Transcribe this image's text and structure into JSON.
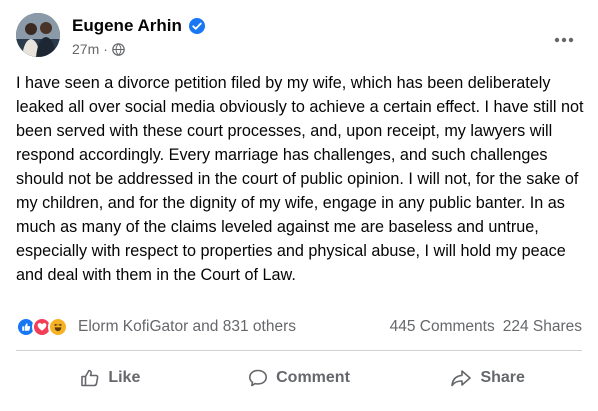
{
  "post": {
    "author": "Eugene Arhin",
    "timestamp": "27m",
    "separator": "·",
    "privacy_icon": "globe-icon",
    "verified_icon": "verified-badge-icon",
    "more_icon": "more-options-icon",
    "body": "I have seen a divorce petition filed by my wife, which has been deliberately leaked all over social media obviously to achieve a certain effect. I have still not been served with these court processes, and, upon receipt, my lawyers will respond accordingly. Every marriage has challenges, and such challenges should not be addressed in the court of public opinion. I will not, for the sake of my children, and for the dignity of my wife, engage in any public banter. In as much as many of the claims leveled against me are baseless and untrue, especially with respect to properties and physical abuse, I will hold my peace and deal with them in the Court of Law."
  },
  "stats": {
    "reaction_icons": [
      "like-reaction-icon",
      "love-reaction-icon",
      "haha-reaction-icon"
    ],
    "reactors": "Elorm KofiGator and 831 others",
    "comments": "445 Comments",
    "shares": "224 Shares"
  },
  "actions": {
    "like": "Like",
    "comment": "Comment",
    "share": "Share"
  },
  "colors": {
    "text": "#050505",
    "secondary": "#65676b",
    "brand_blue": "#1877f2",
    "love_red": "#f33e58",
    "haha_yellow": "#f7b125",
    "divider": "#ced0d4"
  }
}
